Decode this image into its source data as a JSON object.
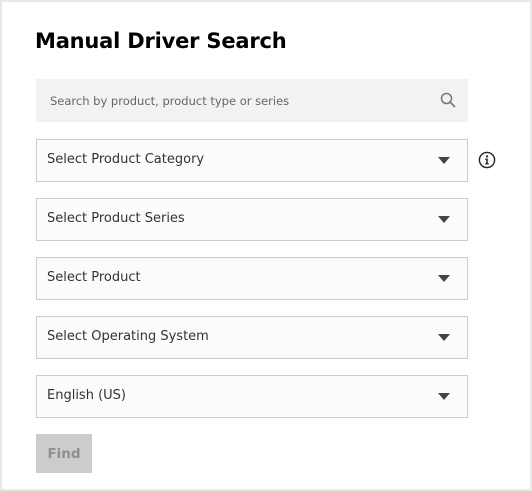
{
  "page": {
    "title": "Manual Driver Search"
  },
  "search": {
    "placeholder": "Search by product, product type or series",
    "value": "",
    "icon": "search-icon"
  },
  "selects": [
    {
      "label": "Select Product Category",
      "icon": "chevron-down-icon"
    },
    {
      "label": "Select Product Series",
      "icon": "chevron-down-icon"
    },
    {
      "label": "Select Product",
      "icon": "chevron-down-icon"
    },
    {
      "label": "Select Operating System",
      "icon": "chevron-down-icon"
    },
    {
      "label": "English (US)",
      "icon": "chevron-down-icon"
    }
  ],
  "info": {
    "icon": "info-icon"
  },
  "find_button": {
    "label": "Find",
    "disabled": true
  },
  "colors": {
    "background": "#ffffff",
    "search_bg": "#f2f2f2",
    "select_border": "#cccccc",
    "button_disabled_bg": "#cccccc",
    "button_disabled_text": "#8f8f8f"
  }
}
